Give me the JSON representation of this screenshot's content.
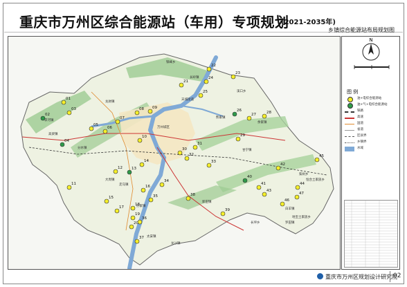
{
  "header": {
    "title": "重庆市万州区综合能源站（车用）专项规划",
    "years": "(2021-2035年)",
    "subtitle": "乡镇综合能源站布局规划图"
  },
  "map": {
    "places": [
      "龙驹镇",
      "天城街道",
      "铁峰乡",
      "长岭镇",
      "万州城区",
      "分水镇",
      "李河镇",
      "熊家镇",
      "甘宁镇",
      "高梁镇",
      "大周镇",
      "走马镇",
      "梨树乡",
      "太安镇",
      "龙沙镇",
      "恒合土家族乡",
      "地宝土家族乡",
      "孙家镇",
      "白羊镇",
      "新田镇",
      "罗田镇",
      "长坪乡",
      "余家镇",
      "溪口乡"
    ],
    "stations": [
      {
        "id": "01",
        "type": "oil-gas"
      },
      {
        "id": "02",
        "type": "oil-gas-hydrogen"
      },
      {
        "id": "03",
        "type": "oil-gas"
      },
      {
        "id": "04",
        "type": "oil-gas-hydrogen"
      },
      {
        "id": "05",
        "type": "oil-gas"
      },
      {
        "id": "06",
        "type": "oil-gas"
      },
      {
        "id": "07",
        "type": "oil-gas"
      },
      {
        "id": "08",
        "type": "oil-gas"
      },
      {
        "id": "09",
        "type": "oil-gas"
      },
      {
        "id": "10",
        "type": "oil-gas"
      },
      {
        "id": "11",
        "type": "oil-gas"
      },
      {
        "id": "12",
        "type": "oil-gas"
      },
      {
        "id": "13",
        "type": "oil-gas-hydrogen"
      },
      {
        "id": "14",
        "type": "oil-gas"
      },
      {
        "id": "15",
        "type": "oil-gas"
      },
      {
        "id": "16",
        "type": "oil-gas"
      },
      {
        "id": "17",
        "type": "oil-gas"
      },
      {
        "id": "18",
        "type": "oil-gas"
      },
      {
        "id": "19",
        "type": "oil-gas"
      },
      {
        "id": "20",
        "type": "oil-gas"
      },
      {
        "id": "21",
        "type": "oil-gas"
      },
      {
        "id": "22",
        "type": "oil-gas"
      },
      {
        "id": "23",
        "type": "oil-gas"
      },
      {
        "id": "24",
        "type": "oil-gas"
      },
      {
        "id": "25",
        "type": "oil-gas"
      },
      {
        "id": "26",
        "type": "oil-gas-hydrogen"
      },
      {
        "id": "27",
        "type": "oil-gas"
      },
      {
        "id": "28",
        "type": "oil-gas"
      },
      {
        "id": "29",
        "type": "oil-gas"
      },
      {
        "id": "30",
        "type": "oil-gas"
      },
      {
        "id": "31",
        "type": "oil-gas"
      },
      {
        "id": "32",
        "type": "oil-gas"
      },
      {
        "id": "33",
        "type": "oil-gas"
      },
      {
        "id": "34",
        "type": "oil-gas"
      },
      {
        "id": "35",
        "type": "oil-gas"
      },
      {
        "id": "36",
        "type": "oil-gas"
      },
      {
        "id": "37",
        "type": "oil-gas"
      },
      {
        "id": "38",
        "type": "oil-gas"
      },
      {
        "id": "39",
        "type": "oil-gas"
      },
      {
        "id": "40",
        "type": "oil-gas-hydrogen"
      },
      {
        "id": "41",
        "type": "oil-gas"
      },
      {
        "id": "42",
        "type": "oil-gas"
      },
      {
        "id": "43",
        "type": "oil-gas"
      },
      {
        "id": "44",
        "type": "oil-gas"
      },
      {
        "id": "45",
        "type": "oil-gas"
      },
      {
        "id": "46",
        "type": "oil-gas"
      },
      {
        "id": "47",
        "type": "oil-gas"
      }
    ],
    "colors": {
      "river": "#7fa9d6",
      "mountain": "#8fbf8f",
      "urban": "#f2e6c4",
      "oil_gas_station": "#f4ee2a",
      "hydrogen_station": "#2f9a4a",
      "boundary": "#555555"
    }
  },
  "compass": {
    "letter": "N"
  },
  "legend": {
    "title": "图 例",
    "items": [
      {
        "label": "油+电综合能源站",
        "symbol": "yellow-dot"
      },
      {
        "label": "油+气+电综合能源站",
        "symbol": "green-dot"
      },
      {
        "label": "铁路",
        "symbol": "rail"
      },
      {
        "label": "高速",
        "symbol": "highway"
      },
      {
        "label": "国道",
        "symbol": "national-road"
      },
      {
        "label": "省道",
        "symbol": "provincial-road"
      },
      {
        "label": "区县界",
        "symbol": "county-border"
      },
      {
        "label": "乡镇界",
        "symbol": "town-border"
      },
      {
        "label": "水域",
        "symbol": "water"
      }
    ]
  },
  "footer": {
    "org": "重庆市万州区规划设计研究院",
    "page": "02"
  }
}
